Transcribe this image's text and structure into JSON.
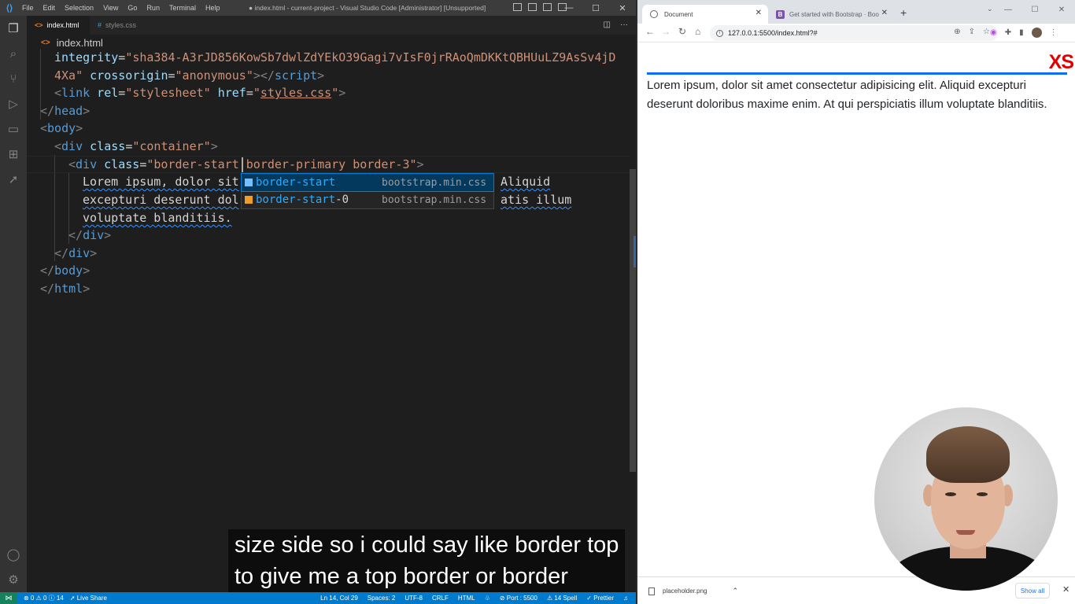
{
  "vscode": {
    "title_bar": {
      "menu": [
        "File",
        "Edit",
        "Selection",
        "View",
        "Go",
        "Run",
        "Terminal",
        "Help"
      ],
      "window_title": "● index.html - current-project - Visual Studio Code [Administrator] [Unsupported]"
    },
    "activity_bar": [
      "files-icon",
      "search-icon",
      "source-control-icon",
      "run-debug-icon",
      "remote-explorer-icon",
      "extensions-icon",
      "live-share-icon",
      "accounts-icon",
      "manage-gear-icon"
    ],
    "tabs": [
      {
        "label": "index.html",
        "active": true,
        "modified": true
      },
      {
        "label": "styles.css",
        "active": false,
        "modified": false
      }
    ],
    "breadcrumb": "index.html",
    "code": {
      "l1a": "integrity",
      "l1b": "=",
      "l1c": "\"sha384-A3rJD856KowSb7dwlZdYEkO39Gagi7vIsF0jrRAoQmDKKtQBHUuLZ9AsSv4jD",
      "l2a": "4Xa\"",
      "l2b": " crossorigin",
      "l2c": "=",
      "l2d": "\"anonymous\"",
      "l2e": "></",
      "l2f": "script",
      "l2g": ">",
      "l3a": "<",
      "l3b": "link",
      "l3c": " rel",
      "l3d": "=",
      "l3e": "\"stylesheet\"",
      "l3f": " href",
      "l3g": "=",
      "l3h": "\"",
      "l3i": "styles.css",
      "l3j": "\"",
      "l3k": ">",
      "l4a": "</",
      "l4b": "head",
      "l4c": ">",
      "l5a": "<",
      "l5b": "body",
      "l5c": ">",
      "l6a": "<",
      "l6b": "div",
      "l6c": " class",
      "l6d": "=",
      "l6e": "\"container\"",
      "l6f": ">",
      "l7a": "<",
      "l7b": "div",
      "l7c": " class",
      "l7d": "=",
      "l7e": "\"border-start",
      "l7f": " border-primary border-3\"",
      "l7g": ">",
      "l8a": "Lorem ipsum, dolor sit",
      "l8b": "Aliquid",
      "l9a": "excepturi deserunt dol",
      "l9b": "atis illum",
      "l10a": "voluptate blanditiis.",
      "l11a": "</",
      "l11b": "div",
      "l11c": ">",
      "l12a": "</",
      "l12b": "div",
      "l12c": ">",
      "l13a": "</",
      "l13b": "body",
      "l13c": ">",
      "l14a": "</",
      "l14b": "html",
      "l14c": ">"
    },
    "suggestions": [
      {
        "match": "border-start",
        "rest": "",
        "source": "bootstrap.min.css",
        "selected": true
      },
      {
        "match": "border-start",
        "rest": "-0",
        "source": "bootstrap.min.css",
        "selected": false
      }
    ],
    "status_bar": {
      "problems": "⊗ 0 ⚠ 0 ⓘ 14",
      "live_share": "Live Share",
      "ln_col": "Ln 14, Col 29",
      "spaces": "Spaces: 2",
      "encoding": "UTF-8",
      "eol": "CRLF",
      "language": "HTML",
      "port": "Port : 5500",
      "spell": "14 Spell",
      "prettier": "Prettier"
    }
  },
  "browser": {
    "tabs": [
      {
        "label": "Document",
        "active": true
      },
      {
        "label": "Get started with Bootstrap · Boo",
        "active": false
      }
    ],
    "url": "127.0.0.1:5500/index.html?#",
    "page": {
      "breakpoint_label": "XS",
      "text": "Lorem ipsum, dolor sit amet consectetur adipisicing elit. Aliquid excepturi deserunt doloribus maxime enim. At qui perspiciatis illum voluptate blanditiis."
    },
    "downloads": {
      "file": "placeholder.png",
      "show_all": "Show all"
    }
  },
  "captions": {
    "line1": "size side so i could say like border top",
    "line2": "to give me a top border or border"
  },
  "colors": {
    "vscode_bg": "#1e1e1e",
    "statusbar": "#007acc",
    "border_primary": "#0d6efd",
    "xs_label": "#e00000"
  }
}
